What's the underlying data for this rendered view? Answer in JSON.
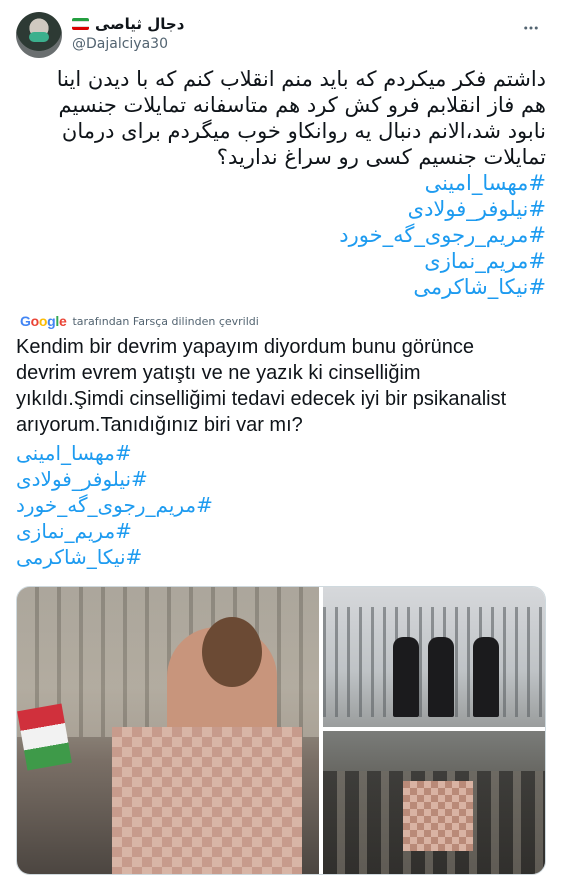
{
  "user": {
    "display_name": "دجال ثیاصی",
    "handle": "@Dajalciya30",
    "flag_colors": [
      "#239f40",
      "#ffffff",
      "#da0000"
    ]
  },
  "tweet": {
    "persian_lines": [
      "داشتم فکر میکردم که باید منم انقلاب کنم که با دیدن اینا",
      "هم فاز انقلابم فرو کش کرد هم متاسفانه تمایلات جنسیم",
      "نابود شد،الانم دنبال یه روانکاو خوب میگردم برای درمان",
      "تمایلات جنسیم کسی رو سراغ ندارید؟"
    ],
    "hashtags": [
      "#مهسا_امینی",
      "#نیلوفر_فولادی",
      "#مریم_رجوی_گه_خورد",
      "#مریم_نمازی",
      "#نیکا_شاکرمی"
    ]
  },
  "translation": {
    "logo": "Google",
    "note": "tarafından Farsça dilinden çevrildi",
    "lines": [
      "Kendim bir devrim yapayım diyordum bunu görünce",
      "devrim evrem yatıştı ve ne yazık ki cinselliğim",
      "yıkıldı.Şimdi cinselliğimi tedavi edecek iyi bir psikanalist",
      "arıyorum.Tanıdığınız biri var mı?"
    ],
    "hashtags": [
      "#مهسا_امینی",
      "#نیلوفر_فولادی",
      "#مریم_رجوی_گه_خورد",
      "#مریم_نمازی",
      "#نیکا_شاکرمی"
    ]
  },
  "colors": {
    "link": "#1d9bf0",
    "muted": "#536471",
    "text": "#0f1419"
  },
  "icons": {
    "more": "more-horizontal-icon"
  }
}
